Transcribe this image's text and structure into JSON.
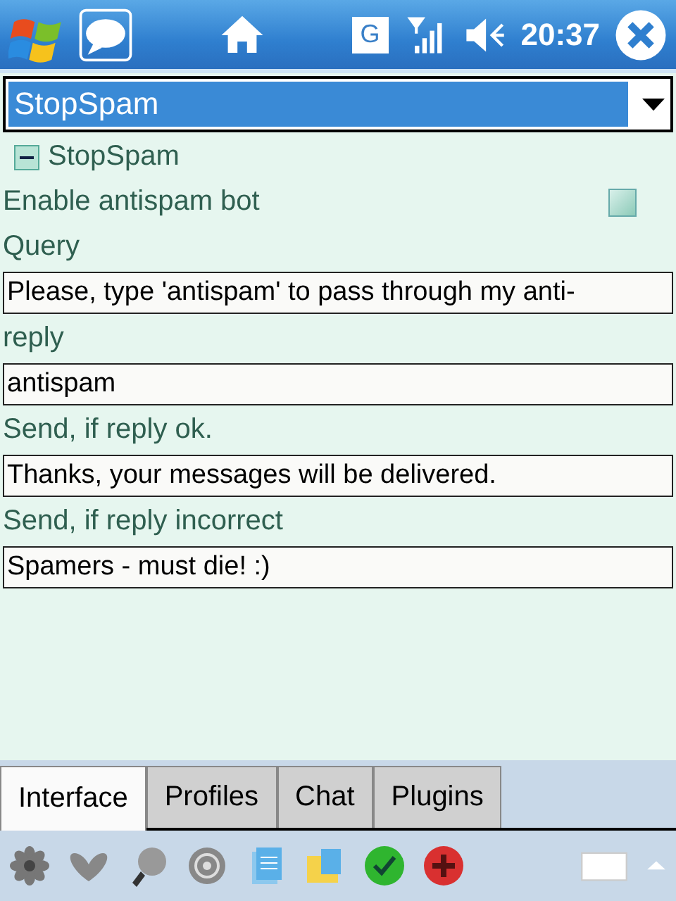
{
  "status_bar": {
    "network_type": "G",
    "time": "20:37"
  },
  "profile_select": {
    "value": "StopSpam"
  },
  "settings": [
    {
      "kind": "tree-node",
      "label": "StopSpam",
      "expanded": true
    },
    {
      "kind": "checkbox",
      "label": "Enable antispam bot",
      "checked": false
    },
    {
      "kind": "label",
      "label": "Query"
    },
    {
      "kind": "field",
      "value": "Please, type 'antispam' to pass through my anti-"
    },
    {
      "kind": "label",
      "label": "reply"
    },
    {
      "kind": "field",
      "value": "antispam"
    },
    {
      "kind": "label",
      "label": "Send, if reply ok."
    },
    {
      "kind": "field",
      "value": "Thanks, your messages will be delivered."
    },
    {
      "kind": "label",
      "label": "Send, if reply incorrect"
    },
    {
      "kind": "field",
      "value": "Spamers - must die! :)"
    }
  ],
  "tabs": [
    {
      "label": "Interface",
      "selected": true
    },
    {
      "label": "Profiles",
      "selected": false
    },
    {
      "label": "Chat",
      "selected": false
    },
    {
      "label": "Plugins",
      "selected": false
    }
  ]
}
